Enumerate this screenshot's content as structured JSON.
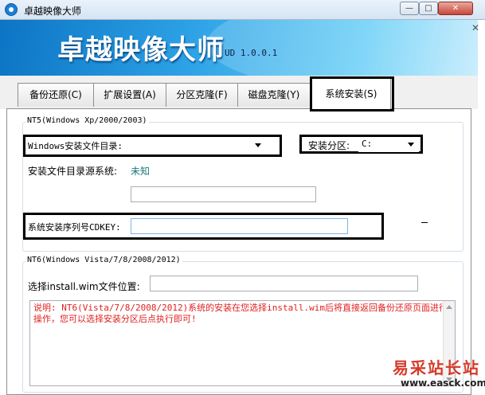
{
  "window": {
    "title": "卓越映像大师",
    "minimize_label": "—",
    "maximize_label": "□",
    "close_label": "✕"
  },
  "banner": {
    "title": "卓越映像大师",
    "version": "UD 1.0.0.1"
  },
  "tabs": [
    {
      "label": "备份还原(C)",
      "active": false
    },
    {
      "label": "扩展设置(A)",
      "active": false
    },
    {
      "label": "分区克隆(F)",
      "active": false
    },
    {
      "label": "磁盘克隆(Y)",
      "active": false
    },
    {
      "label": "系统安装(S)",
      "active": true
    }
  ],
  "nt5": {
    "group_title": "NT5(Windows Xp/2000/2003)",
    "install_dir_label": "Windows安装文件目录:",
    "install_dir_value": "",
    "partition_label": "安装分区:",
    "partition_value": "C:",
    "source_system_label": "安装文件目录源系统:",
    "source_system_value": "未知",
    "source_path_value": "",
    "cdkey_label": "系统安装序列号CDKEY:",
    "cdkey_value": ""
  },
  "nt6": {
    "group_title": "NT6(Windows Vista/7/8/2008/2012)",
    "wim_label": "选择install.wim文件位置:",
    "wim_value": "",
    "note": "说明: NT6(Vista/7/8/2008/2012)系统的安装在您选择install.wim后将直接返回备份还原页面进行操作，您可以选择安装分区后点执行即可!"
  },
  "watermark": {
    "text": "易采站长站",
    "url": "www.easck.com"
  },
  "colors": {
    "banner_start": "#0c74c4",
    "banner_end": "#bfeafd",
    "note_text": "#e02020",
    "status_value": "#1a7a7a"
  }
}
